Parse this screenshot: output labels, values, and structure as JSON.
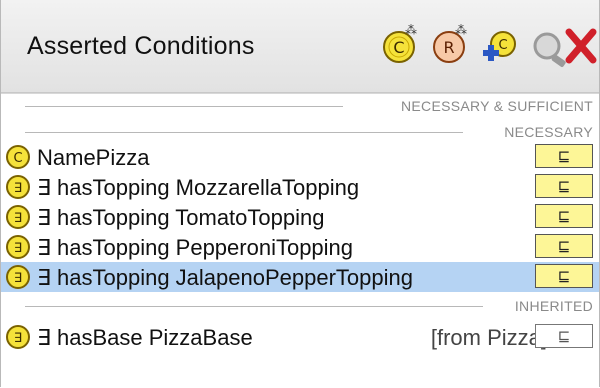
{
  "panel": {
    "title": "Asserted Conditions",
    "toolbar": [
      {
        "name": "add-necessary-condition-button",
        "icon": "class-add-icon"
      },
      {
        "name": "add-restriction-button",
        "icon": "restriction-add-icon"
      },
      {
        "name": "add-named-class-button",
        "icon": "class-plus-icon"
      },
      {
        "name": "search-button",
        "icon": "magnifier-icon"
      },
      {
        "name": "delete-button",
        "icon": "red-x-icon"
      }
    ]
  },
  "sections": {
    "necessary_sufficient": "NECESSARY & SUFFICIENT",
    "necessary": "NECESSARY",
    "inherited": "INHERITED"
  },
  "necessary_rows": [
    {
      "icon": "named-class-icon",
      "text": "NamePizza",
      "symbol": "⊑",
      "selected": false
    },
    {
      "icon": "existential-restriction-icon",
      "text": "∃ hasTopping MozzarellaTopping",
      "symbol": "⊑",
      "selected": false
    },
    {
      "icon": "existential-restriction-icon",
      "text": "∃ hasTopping TomatoTopping",
      "symbol": "⊑",
      "selected": false
    },
    {
      "icon": "existential-restriction-icon",
      "text": "∃ hasTopping PepperoniTopping",
      "symbol": "⊑",
      "selected": false
    },
    {
      "icon": "existential-restriction-icon",
      "text": "∃ hasTopping JalapenoPepperTopping",
      "symbol": "⊑",
      "selected": true
    }
  ],
  "inherited_rows": [
    {
      "icon": "existential-restriction-icon",
      "text": "∃ hasBase PizzaBase",
      "from": "[from Pizza]",
      "symbol": "⊑"
    }
  ],
  "colors": {
    "selection": "#b5d3f3",
    "subclass_badge": "#fdf697",
    "icon_yellow": "#f5e23a",
    "icon_outline": "#7a6200",
    "delete_red": "#d0202a"
  }
}
